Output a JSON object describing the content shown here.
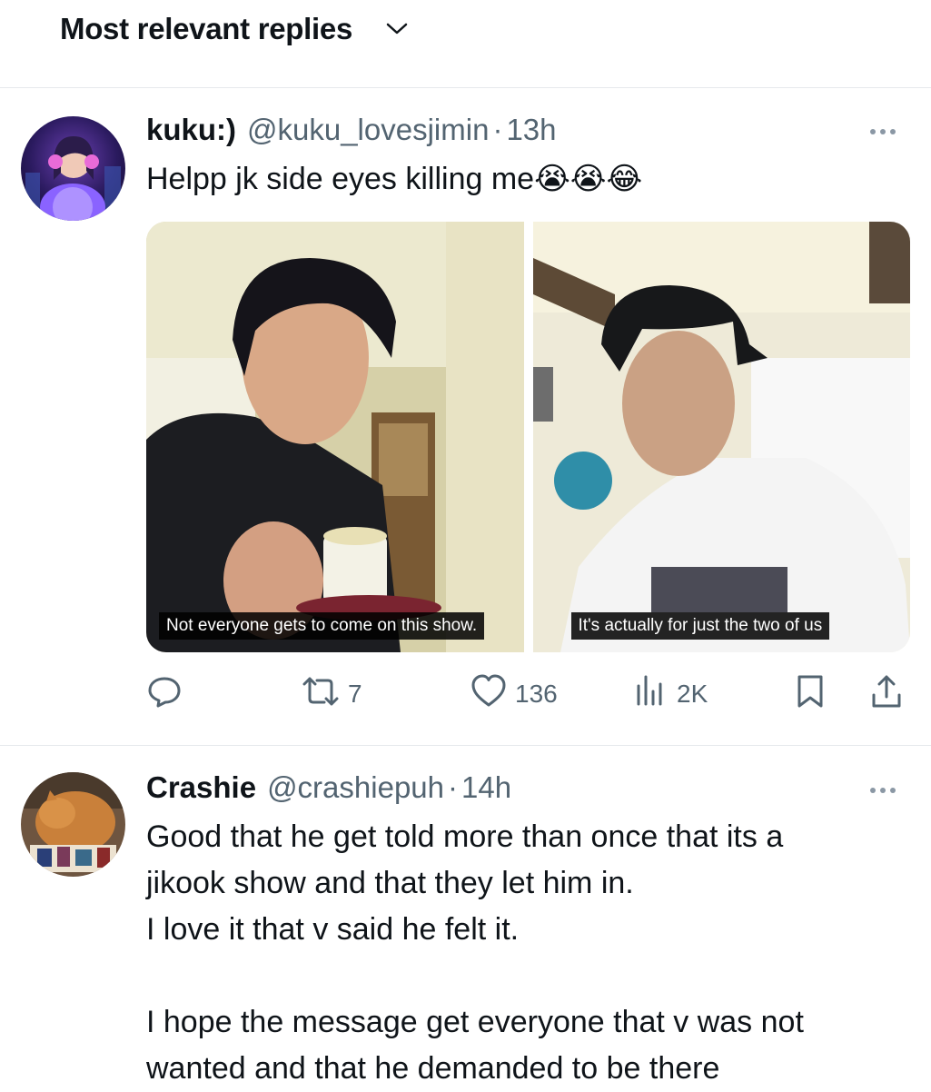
{
  "sort": {
    "label": "Most relevant replies",
    "icon": "chevron-down-icon"
  },
  "replies": [
    {
      "display_name": "kuku:)",
      "handle": "@kuku_lovesjimin",
      "separator": "·",
      "time": "13h",
      "text": "Helpp jk side eyes killing me😭😭😂",
      "media": [
        {
          "caption": "Not everyone gets to come on this show."
        },
        {
          "caption": "It's actually for just the two of us"
        }
      ],
      "actions": {
        "reply_icon": "reply-icon",
        "repost_icon": "repost-icon",
        "repost_count": "7",
        "like_icon": "heart-icon",
        "like_count": "136",
        "views_icon": "views-icon",
        "views_count": "2K",
        "bookmark_icon": "bookmark-icon",
        "share_icon": "share-icon"
      }
    },
    {
      "display_name": "Crashie",
      "handle": "@crashiepuh",
      "separator": "·",
      "time": "14h",
      "text": "Good that he get told more than once that its a\njikook show and that they let him in.\nI love it that v said he felt it.\n\nI hope the message get everyone that v was not\nwanted and that he demanded to be there"
    }
  ],
  "colors": {
    "text": "#0f1419",
    "secondary": "#536471",
    "divider": "#e6e9ec",
    "caption_bg": "#000000"
  }
}
